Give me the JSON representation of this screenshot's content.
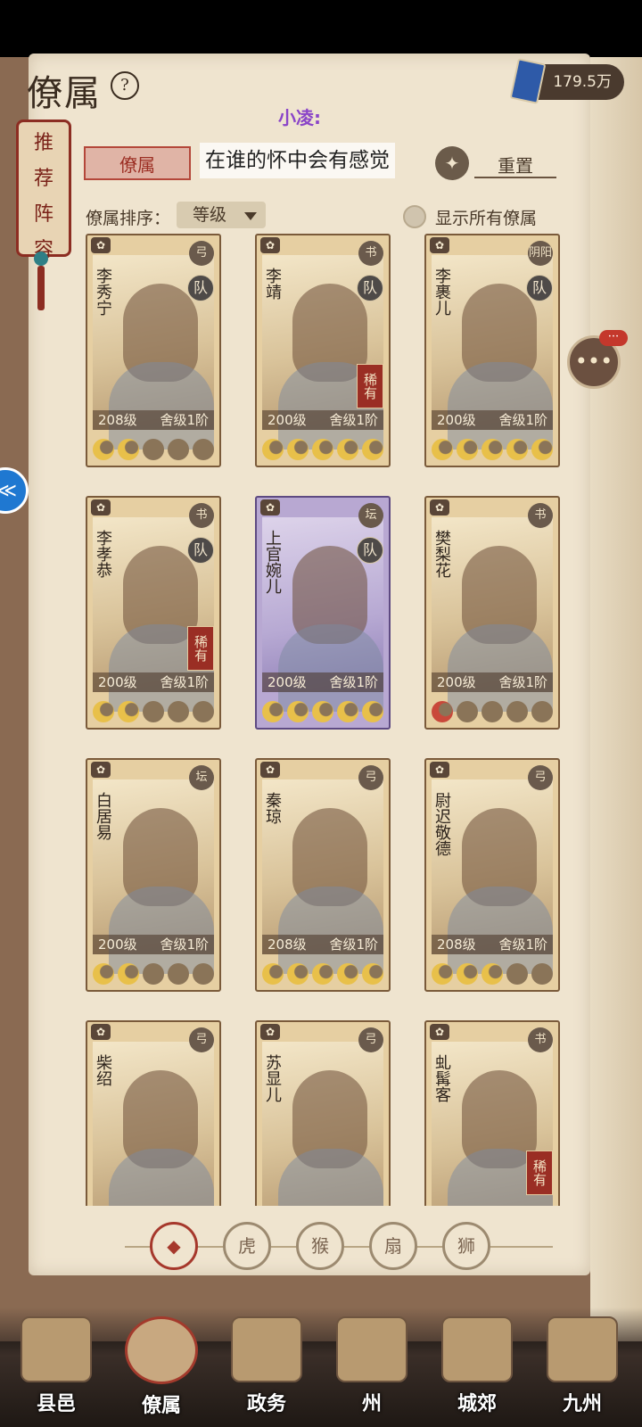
{
  "header": {
    "title": "僚属",
    "help": "?",
    "currency": "179.5万"
  },
  "overlay": {
    "user_label": "小凌:"
  },
  "side_tag": {
    "chars": [
      "推",
      "荐",
      "阵",
      "容"
    ]
  },
  "tabs": {
    "active": "僚属",
    "subtitle": "在谁的怀中会有感觉",
    "reset": "重置"
  },
  "sort": {
    "label": "僚属排序：",
    "value": "等级"
  },
  "toggle": {
    "label": "显示所有僚属"
  },
  "chat": {
    "badge": "···"
  },
  "cards": [
    {
      "name": "李秀宁",
      "lvl": "208级",
      "house": "舍级1阶",
      "team": "队",
      "cls": "弓",
      "moons": 2
    },
    {
      "name": "李靖",
      "lvl": "200级",
      "house": "舍级1阶",
      "team": "队",
      "cls": "书",
      "rare": "稀有",
      "moons": 5
    },
    {
      "name": "李裹儿",
      "lvl": "200级",
      "house": "舍级1阶",
      "team": "队",
      "cls": "阴阳",
      "moons": 5
    },
    {
      "name": "李孝恭",
      "lvl": "200级",
      "house": "舍级1阶",
      "team": "队",
      "cls": "书",
      "rare": "稀有",
      "moons": 2
    },
    {
      "name": "上官婉儿",
      "lvl": "200级",
      "house": "舍级1阶",
      "team": "队",
      "cls": "坛",
      "moons": 5,
      "purple": true
    },
    {
      "name": "樊梨花",
      "lvl": "200级",
      "house": "舍级1阶",
      "cls": "书",
      "moons": 1,
      "red": true
    },
    {
      "name": "白居易",
      "lvl": "200级",
      "house": "舍级1阶",
      "cls": "坛",
      "moons": 2
    },
    {
      "name": "秦琼",
      "lvl": "208级",
      "house": "舍级1阶",
      "cls": "弓",
      "moons": 5
    },
    {
      "name": "尉迟敬德",
      "lvl": "208级",
      "house": "舍级1阶",
      "cls": "弓",
      "moons": 3
    },
    {
      "name": "柴绍",
      "cls": "弓"
    },
    {
      "name": "苏显儿",
      "cls": "弓"
    },
    {
      "name": "虬髯客",
      "cls": "书",
      "rare": "稀有"
    }
  ],
  "filters": [
    "◆",
    "虎",
    "猴",
    "扇",
    "狮"
  ],
  "nav": [
    {
      "label": "县邑"
    },
    {
      "label": "僚属",
      "active": true
    },
    {
      "label": "政务"
    },
    {
      "label": "州"
    },
    {
      "label": "城郊"
    },
    {
      "label": "九州"
    }
  ]
}
